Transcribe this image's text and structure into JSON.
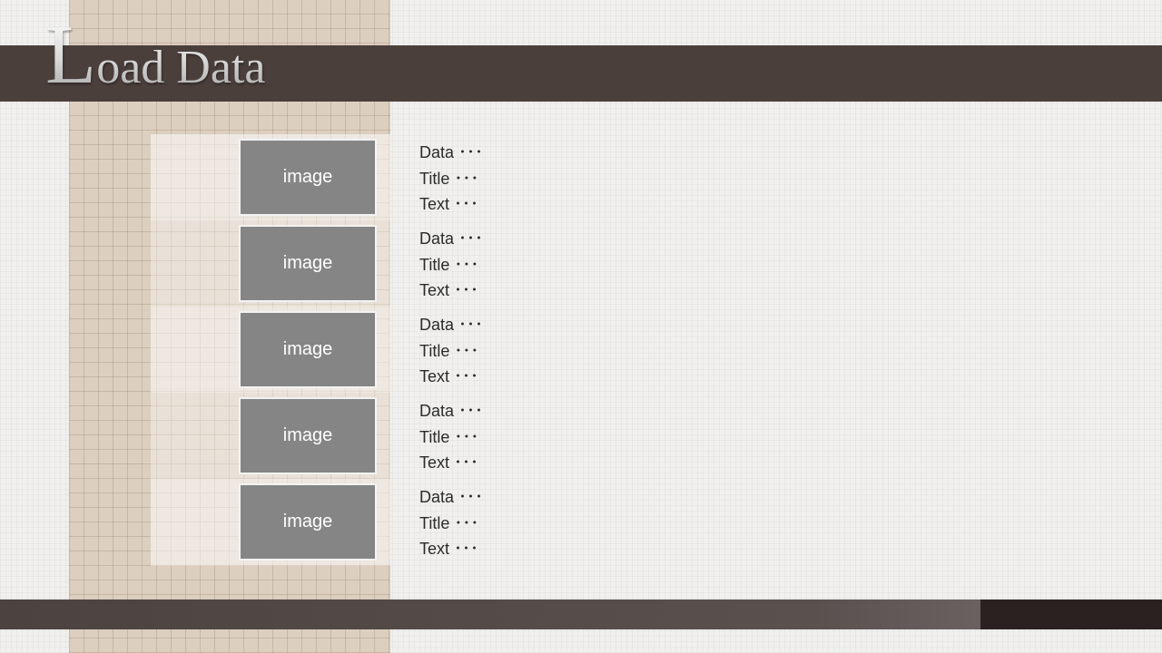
{
  "title": {
    "first_letter": "L",
    "rest": "oad Data"
  },
  "items": [
    {
      "image_label": "image",
      "lines": [
        "Data ･･･",
        "Title ･･･",
        "Text ･･･"
      ]
    },
    {
      "image_label": "image",
      "lines": [
        "Data ･･･",
        "Title ･･･",
        "Text ･･･"
      ]
    },
    {
      "image_label": "image",
      "lines": [
        "Data ･･･",
        "Title ･･･",
        "Text ･･･"
      ]
    },
    {
      "image_label": "image",
      "lines": [
        "Data ･･･",
        "Title ･･･",
        "Text ･･･"
      ]
    },
    {
      "image_label": "image",
      "lines": [
        "Data ･･･",
        "Title ･･･",
        "Text ･･･"
      ]
    }
  ],
  "colors": {
    "title_bar": "#4b3f3c",
    "left_column": "#dccfbf",
    "placeholder": "#858585",
    "footer_accent": "#2a2120"
  }
}
